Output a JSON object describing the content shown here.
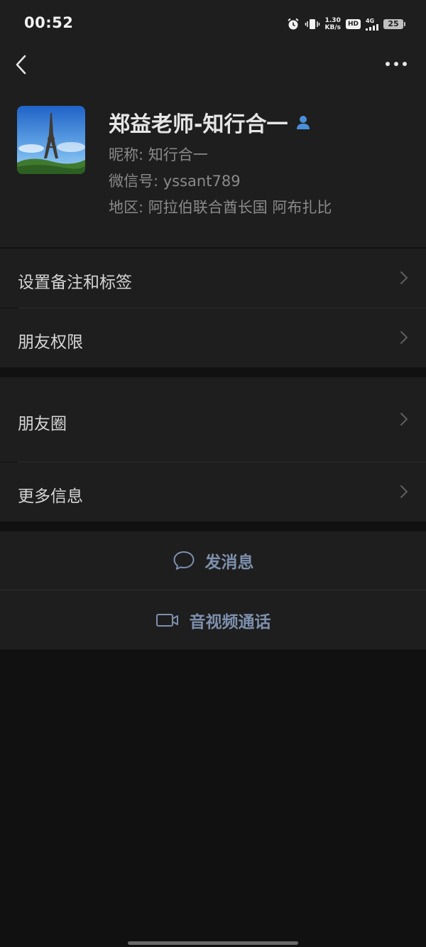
{
  "status_bar": {
    "time": "00:52",
    "speed_value": "1.30",
    "speed_unit": "KB/s",
    "hd": "HD",
    "network": "4G",
    "battery": "25"
  },
  "profile": {
    "name": "郑益老师-知行合一",
    "nickname": "昵称: 知行合一",
    "wechat_id": "微信号: yssant789",
    "region": "地区: 阿拉伯联合酋长国  阿布扎比"
  },
  "menu": {
    "remark": "设置备注和标签",
    "permissions": "朋友权限",
    "moments": "朋友圈",
    "more_info": "更多信息"
  },
  "actions": {
    "message": "发消息",
    "call": "音视频通话"
  },
  "colors": {
    "background": "#111111",
    "panel": "#1e1e1e",
    "accent": "#7d90ad",
    "badge": "#4a90d9"
  }
}
